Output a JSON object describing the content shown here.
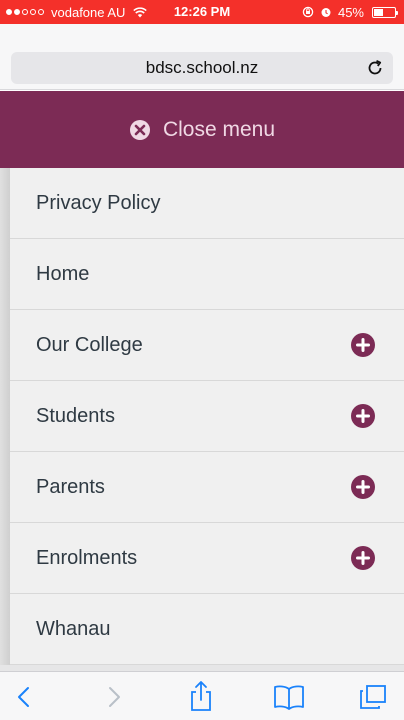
{
  "status_bar": {
    "carrier": "vodafone AU",
    "time": "12:26 PM",
    "battery_percent": "45%",
    "battery_level": 0.45,
    "signal_bars": 2,
    "signal_max": 5
  },
  "browser": {
    "url": "bdsc.school.nz"
  },
  "menu": {
    "close_label": "Close menu",
    "items": [
      {
        "label": "Privacy Policy",
        "expandable": false
      },
      {
        "label": "Home",
        "expandable": false
      },
      {
        "label": "Our College",
        "expandable": true
      },
      {
        "label": "Students",
        "expandable": true
      },
      {
        "label": "Parents",
        "expandable": true
      },
      {
        "label": "Enrolments",
        "expandable": true
      },
      {
        "label": "Whanau",
        "expandable": false
      }
    ]
  },
  "colors": {
    "status_bar": "#f4302a",
    "brand": "#7c2b55",
    "toolbar_icon": "#1a82fb"
  },
  "icons": [
    "wifi-icon",
    "alarm-icon",
    "lock-rotation-icon",
    "battery-icon",
    "reload-icon",
    "close-icon",
    "plus-icon",
    "back-icon",
    "forward-icon",
    "share-icon",
    "bookmarks-icon",
    "tabs-icon"
  ]
}
